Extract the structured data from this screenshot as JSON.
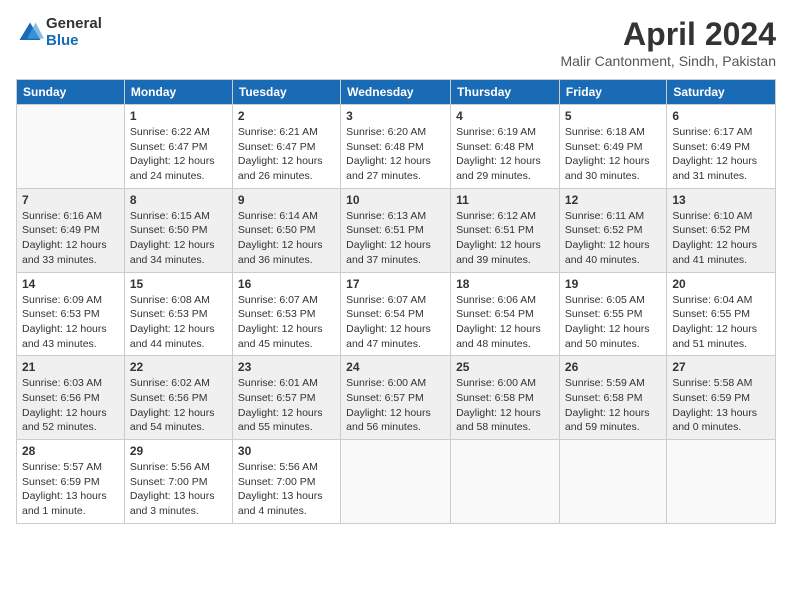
{
  "header": {
    "logo_general": "General",
    "logo_blue": "Blue",
    "month_title": "April 2024",
    "location": "Malir Cantonment, Sindh, Pakistan"
  },
  "weekdays": [
    "Sunday",
    "Monday",
    "Tuesday",
    "Wednesday",
    "Thursday",
    "Friday",
    "Saturday"
  ],
  "weeks": [
    [
      {
        "day": "",
        "info": ""
      },
      {
        "day": "1",
        "info": "Sunrise: 6:22 AM\nSunset: 6:47 PM\nDaylight: 12 hours and 24 minutes."
      },
      {
        "day": "2",
        "info": "Sunrise: 6:21 AM\nSunset: 6:47 PM\nDaylight: 12 hours and 26 minutes."
      },
      {
        "day": "3",
        "info": "Sunrise: 6:20 AM\nSunset: 6:48 PM\nDaylight: 12 hours and 27 minutes."
      },
      {
        "day": "4",
        "info": "Sunrise: 6:19 AM\nSunset: 6:48 PM\nDaylight: 12 hours and 29 minutes."
      },
      {
        "day": "5",
        "info": "Sunrise: 6:18 AM\nSunset: 6:49 PM\nDaylight: 12 hours and 30 minutes."
      },
      {
        "day": "6",
        "info": "Sunrise: 6:17 AM\nSunset: 6:49 PM\nDaylight: 12 hours and 31 minutes."
      }
    ],
    [
      {
        "day": "7",
        "info": "Sunrise: 6:16 AM\nSunset: 6:49 PM\nDaylight: 12 hours and 33 minutes."
      },
      {
        "day": "8",
        "info": "Sunrise: 6:15 AM\nSunset: 6:50 PM\nDaylight: 12 hours and 34 minutes."
      },
      {
        "day": "9",
        "info": "Sunrise: 6:14 AM\nSunset: 6:50 PM\nDaylight: 12 hours and 36 minutes."
      },
      {
        "day": "10",
        "info": "Sunrise: 6:13 AM\nSunset: 6:51 PM\nDaylight: 12 hours and 37 minutes."
      },
      {
        "day": "11",
        "info": "Sunrise: 6:12 AM\nSunset: 6:51 PM\nDaylight: 12 hours and 39 minutes."
      },
      {
        "day": "12",
        "info": "Sunrise: 6:11 AM\nSunset: 6:52 PM\nDaylight: 12 hours and 40 minutes."
      },
      {
        "day": "13",
        "info": "Sunrise: 6:10 AM\nSunset: 6:52 PM\nDaylight: 12 hours and 41 minutes."
      }
    ],
    [
      {
        "day": "14",
        "info": "Sunrise: 6:09 AM\nSunset: 6:53 PM\nDaylight: 12 hours and 43 minutes."
      },
      {
        "day": "15",
        "info": "Sunrise: 6:08 AM\nSunset: 6:53 PM\nDaylight: 12 hours and 44 minutes."
      },
      {
        "day": "16",
        "info": "Sunrise: 6:07 AM\nSunset: 6:53 PM\nDaylight: 12 hours and 45 minutes."
      },
      {
        "day": "17",
        "info": "Sunrise: 6:07 AM\nSunset: 6:54 PM\nDaylight: 12 hours and 47 minutes."
      },
      {
        "day": "18",
        "info": "Sunrise: 6:06 AM\nSunset: 6:54 PM\nDaylight: 12 hours and 48 minutes."
      },
      {
        "day": "19",
        "info": "Sunrise: 6:05 AM\nSunset: 6:55 PM\nDaylight: 12 hours and 50 minutes."
      },
      {
        "day": "20",
        "info": "Sunrise: 6:04 AM\nSunset: 6:55 PM\nDaylight: 12 hours and 51 minutes."
      }
    ],
    [
      {
        "day": "21",
        "info": "Sunrise: 6:03 AM\nSunset: 6:56 PM\nDaylight: 12 hours and 52 minutes."
      },
      {
        "day": "22",
        "info": "Sunrise: 6:02 AM\nSunset: 6:56 PM\nDaylight: 12 hours and 54 minutes."
      },
      {
        "day": "23",
        "info": "Sunrise: 6:01 AM\nSunset: 6:57 PM\nDaylight: 12 hours and 55 minutes."
      },
      {
        "day": "24",
        "info": "Sunrise: 6:00 AM\nSunset: 6:57 PM\nDaylight: 12 hours and 56 minutes."
      },
      {
        "day": "25",
        "info": "Sunrise: 6:00 AM\nSunset: 6:58 PM\nDaylight: 12 hours and 58 minutes."
      },
      {
        "day": "26",
        "info": "Sunrise: 5:59 AM\nSunset: 6:58 PM\nDaylight: 12 hours and 59 minutes."
      },
      {
        "day": "27",
        "info": "Sunrise: 5:58 AM\nSunset: 6:59 PM\nDaylight: 13 hours and 0 minutes."
      }
    ],
    [
      {
        "day": "28",
        "info": "Sunrise: 5:57 AM\nSunset: 6:59 PM\nDaylight: 13 hours and 1 minute."
      },
      {
        "day": "29",
        "info": "Sunrise: 5:56 AM\nSunset: 7:00 PM\nDaylight: 13 hours and 3 minutes."
      },
      {
        "day": "30",
        "info": "Sunrise: 5:56 AM\nSunset: 7:00 PM\nDaylight: 13 hours and 4 minutes."
      },
      {
        "day": "",
        "info": ""
      },
      {
        "day": "",
        "info": ""
      },
      {
        "day": "",
        "info": ""
      },
      {
        "day": "",
        "info": ""
      }
    ]
  ]
}
